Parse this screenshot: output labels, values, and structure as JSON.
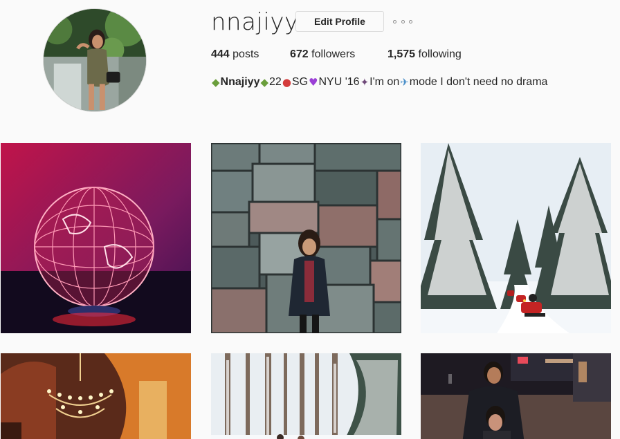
{
  "profile": {
    "username": "nnajiyy",
    "edit_profile_label": "Edit Profile",
    "stats": {
      "posts_count": "444",
      "posts_label": " posts",
      "followers_count": "672",
      "followers_label": " followers",
      "following_count": "1,575",
      "following_label": " following"
    },
    "bio": {
      "name": "Nnajiyy",
      "age_text": "22 ",
      "location_text": "SG ",
      "school_text": "NYU '16",
      "tail_a": "I'm on ",
      "tail_b": "mode I don't need no drama"
    }
  },
  "icons": {
    "money": "money-with-wings-icon",
    "pin": "round-pushpin-icon",
    "heart": "purple-heart-icon",
    "bottle": "champagne-bottle-icon",
    "plane": "airplane-icon",
    "more": "more-options-icon"
  },
  "colors": {
    "background": "#fafafa",
    "text": "#262626",
    "border": "#dbdbdb"
  },
  "posts": [
    {
      "subject": "globe-sculpture"
    },
    {
      "subject": "stone-wall-portrait"
    },
    {
      "subject": "snowy-forest-snowmobiles"
    },
    {
      "subject": "chandelier-ceiling"
    },
    {
      "subject": "snowy-birch-forest"
    },
    {
      "subject": "couple-night-street"
    }
  ]
}
